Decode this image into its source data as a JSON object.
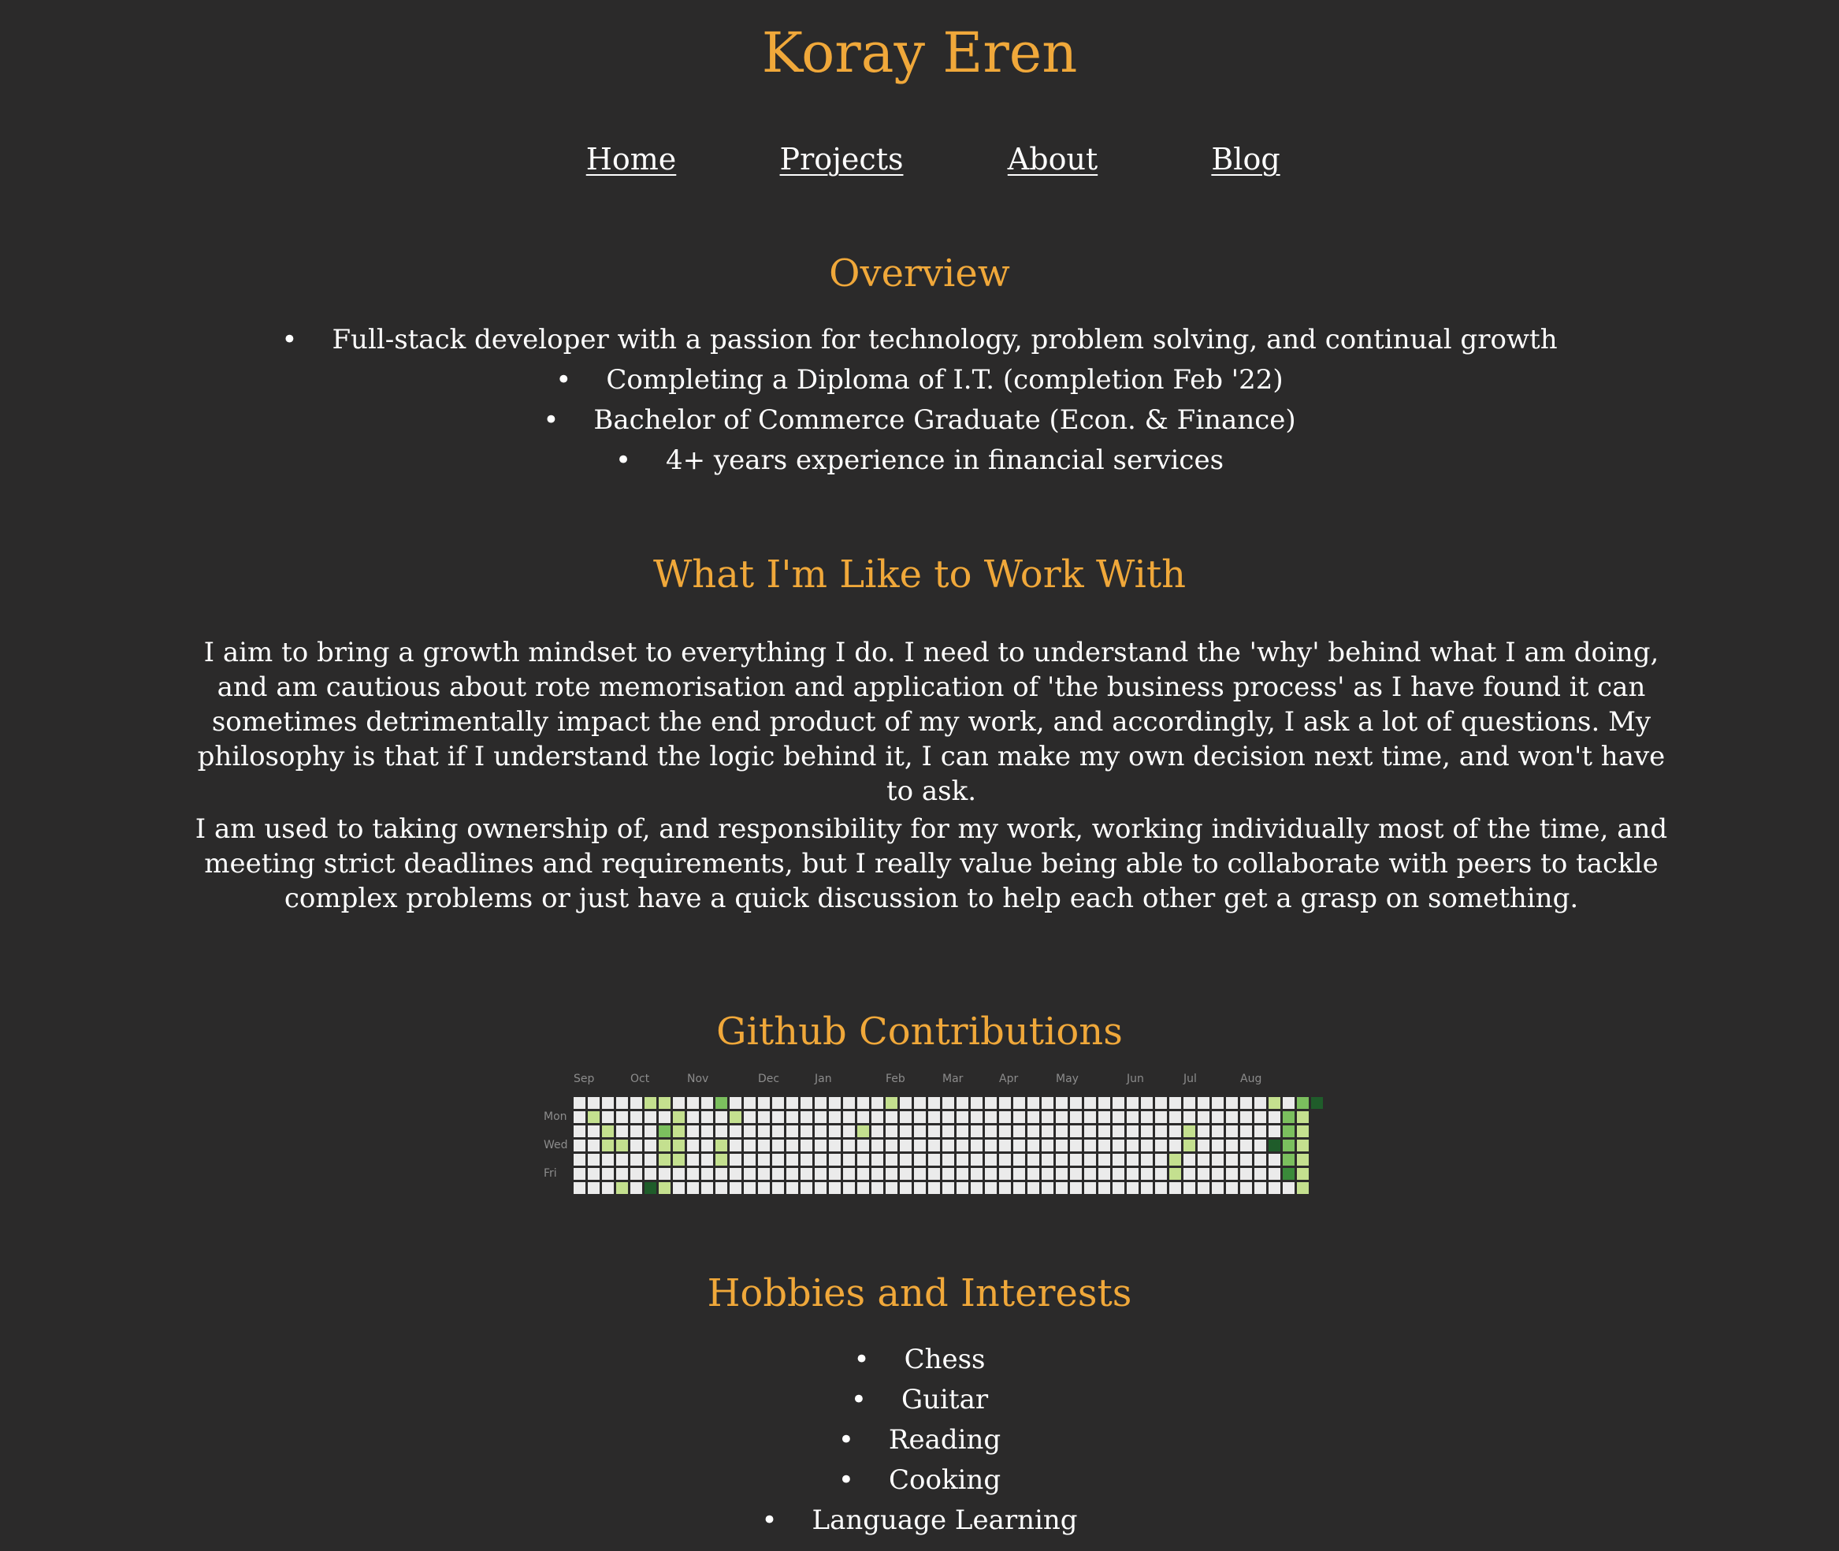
{
  "site": {
    "title": "Koray Eren"
  },
  "nav": {
    "items": [
      "Home",
      "Projects",
      "About",
      "Blog"
    ]
  },
  "overview": {
    "title": "Overview",
    "items": [
      "Full-stack developer with a passion for technology, problem solving, and continual growth",
      "Completing a Diploma of I.T. (completion Feb '22)",
      "Bachelor of Commerce Graduate (Econ. & Finance)",
      "4+ years experience in financial services"
    ]
  },
  "work": {
    "title": "What I'm Like to Work With",
    "paragraphs": [
      "I aim to bring a growth mindset to everything I do. I need to understand the 'why' behind what I am doing, and am cautious about rote memorisation and application of 'the business process' as I have found it can sometimes detrimentally impact the end product of my work, and accordingly, I ask a lot of questions. My philosophy is that if I understand the logic behind it, I can make my own decision next time, and won't have to ask.",
      "I am used to taking ownership of, and responsibility for my work, working individually most of the time, and meeting strict deadlines and requirements, but I really value being able to collaborate with peers to tackle complex problems or just have a quick discussion to help each other get a grasp on something."
    ]
  },
  "github": {
    "title": "Github Contributions",
    "months": [
      {
        "label": "Sep",
        "week": 0
      },
      {
        "label": "Oct",
        "week": 4
      },
      {
        "label": "Nov",
        "week": 8
      },
      {
        "label": "Dec",
        "week": 13
      },
      {
        "label": "Jan",
        "week": 17
      },
      {
        "label": "Feb",
        "week": 22
      },
      {
        "label": "Mar",
        "week": 26
      },
      {
        "label": "Apr",
        "week": 30
      },
      {
        "label": "May",
        "week": 34
      },
      {
        "label": "Jun",
        "week": 39
      },
      {
        "label": "Jul",
        "week": 43
      },
      {
        "label": "Aug",
        "week": 47
      }
    ],
    "days": [
      {
        "label": "Mon",
        "row": 1
      },
      {
        "label": "Wed",
        "row": 3
      },
      {
        "label": "Fri",
        "row": 5
      }
    ],
    "weeks": 52,
    "colors": [
      "#ebebeb",
      "#c4e08f",
      "#7bbf5e",
      "#3a8a3a",
      "#1f5c2a"
    ],
    "contributions": [
      {
        "week": 0,
        "day": 0,
        "level": 0
      },
      {
        "week": 1,
        "day": 1,
        "level": 1
      },
      {
        "week": 2,
        "day": 2,
        "level": 1
      },
      {
        "week": 2,
        "day": 3,
        "level": 1
      },
      {
        "week": 3,
        "day": 3,
        "level": 1
      },
      {
        "week": 3,
        "day": 6,
        "level": 1
      },
      {
        "week": 5,
        "day": 0,
        "level": 1
      },
      {
        "week": 5,
        "day": 6,
        "level": 4
      },
      {
        "week": 6,
        "day": 0,
        "level": 1
      },
      {
        "week": 6,
        "day": 2,
        "level": 2
      },
      {
        "week": 6,
        "day": 3,
        "level": 1
      },
      {
        "week": 6,
        "day": 4,
        "level": 1
      },
      {
        "week": 6,
        "day": 6,
        "level": 1
      },
      {
        "week": 7,
        "day": 1,
        "level": 1
      },
      {
        "week": 7,
        "day": 2,
        "level": 1
      },
      {
        "week": 7,
        "day": 3,
        "level": 1
      },
      {
        "week": 7,
        "day": 4,
        "level": 1
      },
      {
        "week": 10,
        "day": 0,
        "level": 2
      },
      {
        "week": 10,
        "day": 3,
        "level": 1
      },
      {
        "week": 10,
        "day": 4,
        "level": 1
      },
      {
        "week": 11,
        "day": 1,
        "level": 1
      },
      {
        "week": 20,
        "day": 2,
        "level": 1
      },
      {
        "week": 22,
        "day": 0,
        "level": 1
      },
      {
        "week": 42,
        "day": 4,
        "level": 1
      },
      {
        "week": 42,
        "day": 5,
        "level": 1
      },
      {
        "week": 43,
        "day": 2,
        "level": 1
      },
      {
        "week": 43,
        "day": 3,
        "level": 1
      },
      {
        "week": 49,
        "day": 0,
        "level": 1
      },
      {
        "week": 49,
        "day": 3,
        "level": 4
      },
      {
        "week": 50,
        "day": 1,
        "level": 2
      },
      {
        "week": 50,
        "day": 2,
        "level": 2
      },
      {
        "week": 50,
        "day": 3,
        "level": 2
      },
      {
        "week": 50,
        "day": 4,
        "level": 2
      },
      {
        "week": 50,
        "day": 5,
        "level": 3
      },
      {
        "week": 51,
        "day": 0,
        "level": 2
      },
      {
        "week": 51,
        "day": 1,
        "level": 1
      },
      {
        "week": 51,
        "day": 2,
        "level": 1
      },
      {
        "week": 51,
        "day": 3,
        "level": 1
      },
      {
        "week": 51,
        "day": 4,
        "level": 1
      },
      {
        "week": 51,
        "day": 5,
        "level": 1
      },
      {
        "week": 51,
        "day": 6,
        "level": 1
      },
      {
        "week": 52,
        "day": 0,
        "level": 4
      }
    ]
  },
  "hobbies": {
    "title": "Hobbies and Interests",
    "items": [
      "Chess",
      "Guitar",
      "Reading",
      "Cooking",
      "Language Learning"
    ]
  }
}
